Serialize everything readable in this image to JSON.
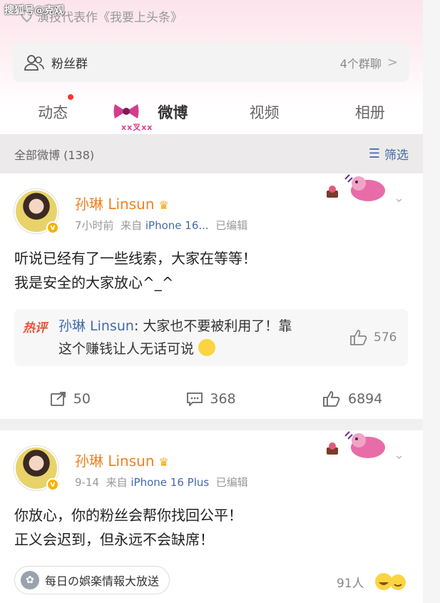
{
  "watermark": "搜狐号@克观",
  "previous_line": "演技代表作《我要上头条》",
  "fans_group": {
    "label": "粉丝群",
    "count": "4个群聊",
    "chevron": ">"
  },
  "tabs": [
    {
      "label": "动态",
      "has_dot": true
    },
    {
      "label": "微博",
      "active": true,
      "sub": "xx叉xx"
    },
    {
      "label": "视频"
    },
    {
      "label": "相册"
    }
  ],
  "filter": {
    "label": "全部微博 (138)",
    "button": "筛选",
    "icon": "filter-icon"
  },
  "posts": [
    {
      "author": "孙琳 Linsun",
      "time": "7小时前",
      "source_prefix": "来自",
      "device": "iPhone 16...",
      "edited": "已编辑",
      "text_lines": [
        "听说已经有了一些线索，大家在等等！",
        "我是安全的大家放心^_^"
      ],
      "hot_comment": {
        "tag": "热评",
        "author": "孙琳 Linsun",
        "text_line1": ": 大家也不要被利用了！靠",
        "text_line2": "这个赚钱让人无话可说",
        "likes": "576"
      },
      "actions": {
        "reposts": "50",
        "comments": "368",
        "likes": "6894"
      }
    },
    {
      "author": "孙琳 Linsun",
      "time": "9-14",
      "source_prefix": "来自",
      "device": "iPhone 16 Plus",
      "edited": "已编辑",
      "text_lines": [
        "你放心，你的粉丝会帮你找回公平！",
        "正义会迟到，但永远不会缺席！"
      ],
      "topic": "每日の娯楽情報大放送",
      "readers": "91人"
    }
  ],
  "colors": {
    "accent_blue": "#446aa9",
    "name_orange": "#f0801f",
    "hot_red": "#e8543c"
  }
}
